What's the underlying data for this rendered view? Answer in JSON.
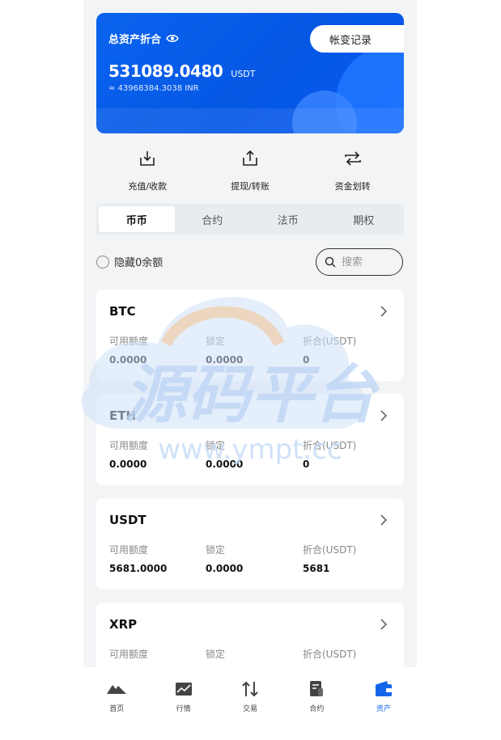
{
  "asset": {
    "title": "总资产折合",
    "amount": "531089.0480",
    "unit": "USDT",
    "inr": "≈ 43968384.3038 INR",
    "record_button": "帐变记录"
  },
  "actions": [
    {
      "label": "充值/收款",
      "icon": "download-icon"
    },
    {
      "label": "提现/转账",
      "icon": "upload-icon"
    },
    {
      "label": "资金划转",
      "icon": "transfer-icon"
    }
  ],
  "tabs": [
    "币币",
    "合约",
    "法币",
    "期权"
  ],
  "filter": {
    "hide_zero": "隐藏0余额",
    "search_placeholder": "搜索"
  },
  "coins": [
    {
      "name": "BTC",
      "available_label": "可用额度",
      "locked_label": "锁定",
      "value_label": "折合(USDT)",
      "available": "0.0000",
      "locked": "0.0000",
      "value": "0"
    },
    {
      "name": "ETH",
      "available_label": "可用额度",
      "locked_label": "锁定",
      "value_label": "折合(USDT)",
      "available": "0.0000",
      "locked": "0.0000",
      "value": "0"
    },
    {
      "name": "USDT",
      "available_label": "可用额度",
      "locked_label": "锁定",
      "value_label": "折合(USDT)",
      "available": "5681.0000",
      "locked": "0.0000",
      "value": "5681"
    },
    {
      "name": "XRP",
      "available_label": "可用额度",
      "locked_label": "锁定",
      "value_label": "折合(USDT)",
      "available": "",
      "locked": "",
      "value": ""
    }
  ],
  "watermark": {
    "text": "源码平台",
    "url": "www.ympt.cc"
  },
  "nav": [
    {
      "label": "首页",
      "icon": "mountain-icon"
    },
    {
      "label": "行情",
      "icon": "chart-icon"
    },
    {
      "label": "交易",
      "icon": "swap-icon"
    },
    {
      "label": "合约",
      "icon": "document-icon"
    },
    {
      "label": "资产",
      "icon": "wallet-icon"
    }
  ],
  "colors": {
    "accent": "#0b5ff0",
    "nav_active": "#1565e8"
  }
}
